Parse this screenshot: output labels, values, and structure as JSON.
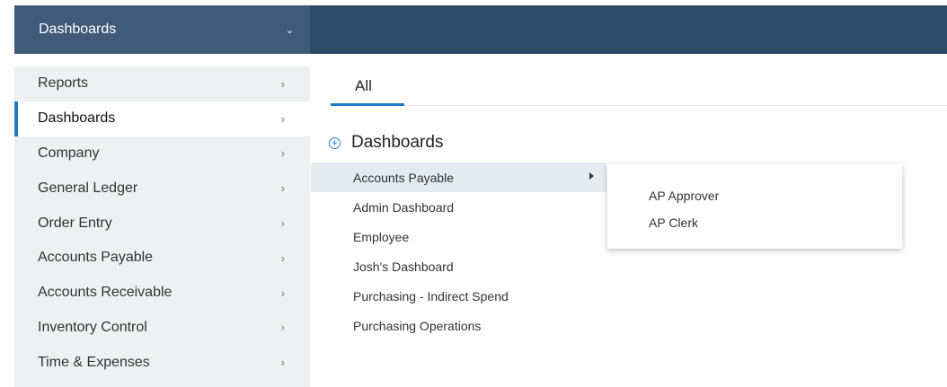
{
  "topbar": {
    "menu_label": "Dashboards",
    "menu_chevron": "⌄"
  },
  "sidebar": {
    "items": [
      {
        "label": "Reports",
        "arrow": "›"
      },
      {
        "label": "Dashboards",
        "arrow": "›"
      },
      {
        "label": "Company",
        "arrow": "›"
      },
      {
        "label": "General Ledger",
        "arrow": "›"
      },
      {
        "label": "Order Entry",
        "arrow": "›"
      },
      {
        "label": "Accounts Payable",
        "arrow": "›"
      },
      {
        "label": "Accounts Receivable",
        "arrow": "›"
      },
      {
        "label": "Inventory Control",
        "arrow": "›"
      },
      {
        "label": "Time & Expenses",
        "arrow": "›"
      }
    ],
    "active_index": 1
  },
  "main": {
    "tabs": [
      {
        "label": "All"
      }
    ],
    "section_title": "Dashboards",
    "dashboards": [
      {
        "label": "Accounts Payable"
      },
      {
        "label": "Admin Dashboard"
      },
      {
        "label": "Employee"
      },
      {
        "label": "Josh's Dashboard"
      },
      {
        "label": "Purchasing - Indirect Spend"
      },
      {
        "label": "Purchasing Operations"
      }
    ],
    "submenu": [
      {
        "label": "AP Approver"
      },
      {
        "label": "AP Clerk"
      }
    ]
  },
  "colors": {
    "topbar": "#2d4a66",
    "topbar_menu": "#405a79",
    "accent": "#1f7ac7",
    "sidebar_bg": "#eff0f1",
    "selected_row": "#e4eaef"
  },
  "icons": {
    "section_expand": "plus-circle-icon",
    "submenu_caret": "caret-right-icon"
  }
}
